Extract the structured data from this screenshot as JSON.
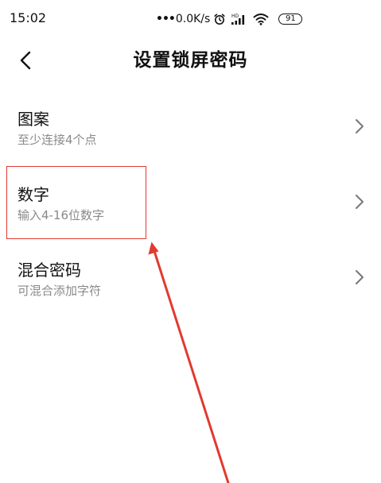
{
  "status_bar": {
    "time": "15:02",
    "dots": "•••",
    "net_speed": "0.0K/s",
    "hd_label": "HD",
    "battery": "91"
  },
  "header": {
    "title": "设置锁屏密码"
  },
  "options": [
    {
      "title": "图案",
      "subtitle": "至少连接4个点"
    },
    {
      "title": "数字",
      "subtitle": "输入4-16位数字"
    },
    {
      "title": "混合密码",
      "subtitle": "可混合添加字符"
    }
  ],
  "colors": {
    "annotation": "#e23a2f",
    "subtitle": "#8a8a8a",
    "chevron": "#777777"
  }
}
